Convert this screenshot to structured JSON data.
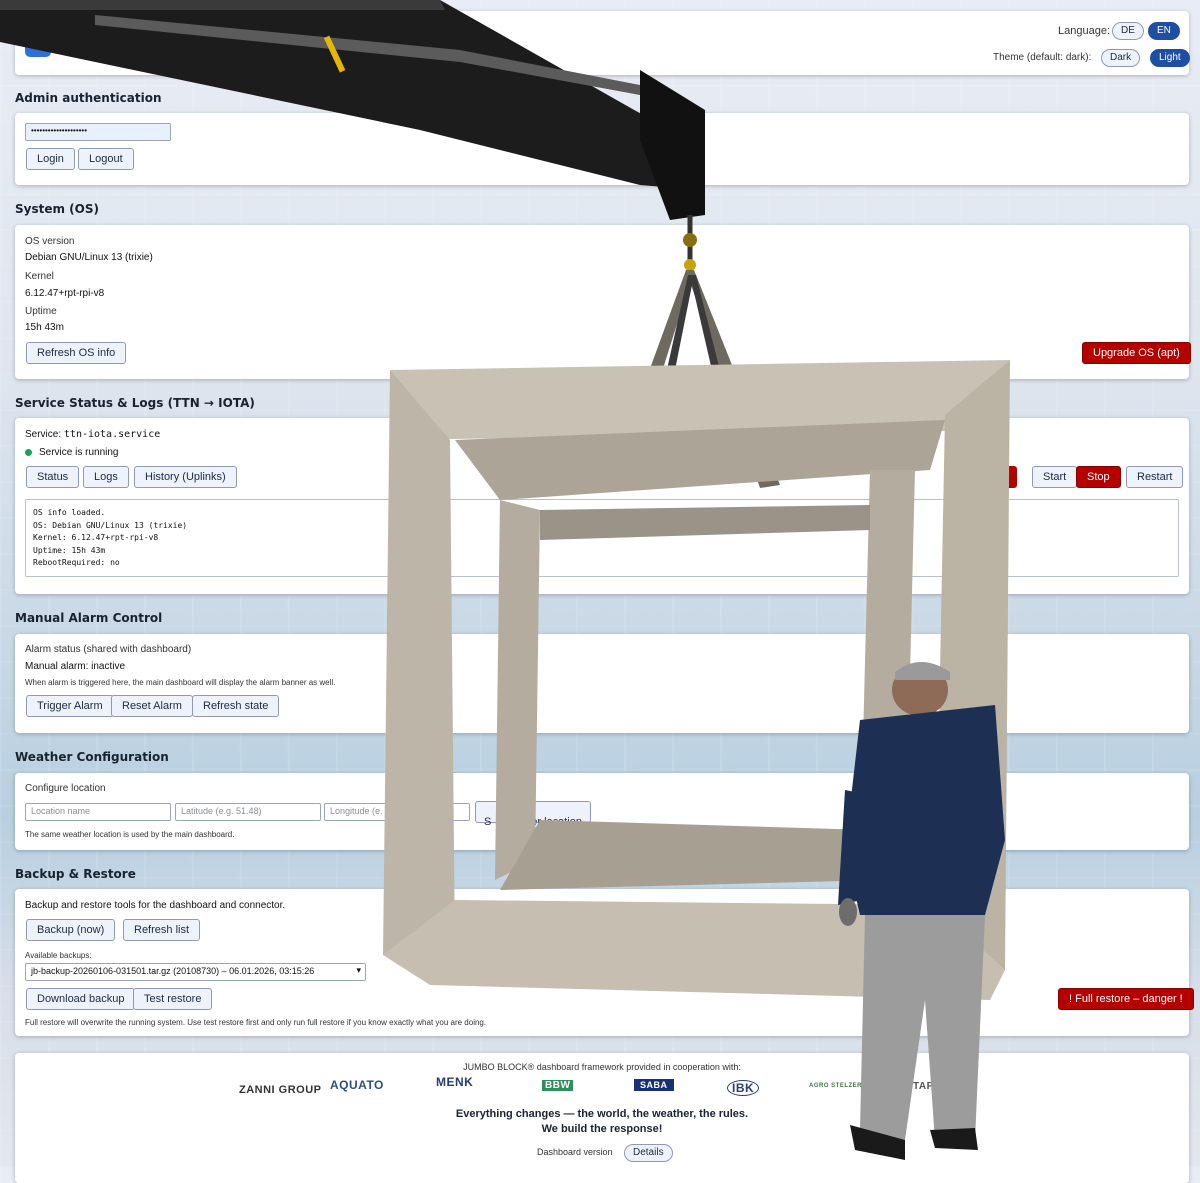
{
  "header": {
    "language_label": "Language:",
    "lang_de": "DE",
    "lang_en": "EN",
    "theme_label": "Theme (default: dark):",
    "theme_dark": "Dark",
    "theme_light": "Light"
  },
  "admin": {
    "title": "Admin authentication",
    "password_value": "••••••••••••••••••••",
    "login": "Login",
    "logout": "Logout"
  },
  "system": {
    "title": "System (OS)",
    "os_version_label": "OS version",
    "os_version": "Debian GNU/Linux 13 (trixie)",
    "kernel_label": "Kernel",
    "kernel": "6.12.47+rpt-rpi-v8",
    "uptime_label": "Uptime",
    "uptime": "15h 43m",
    "refresh": "Refresh OS info",
    "upgrade": "Upgrade OS (apt)"
  },
  "service": {
    "title": "Service Status & Logs (TTN → IOTA)",
    "service_prefix": "Service:",
    "service_name": "ttn-iota.service",
    "status_text": "Service is running",
    "status_color": "#1aa35c",
    "btn_status": "Status",
    "btn_logs": "Logs",
    "btn_history": "History (Uplinks)",
    "btn_start": "Start",
    "btn_stop": "Stop",
    "btn_restart": "Restart",
    "log": "OS info loaded.\nOS: Debian GNU/Linux 13 (trixie)\nKernel: 6.12.47+rpt-rpi-v8\nUptime: 15h 43m\nRebootRequired: no"
  },
  "alarm": {
    "title": "Manual Alarm Control",
    "status_label": "Alarm status (shared with dashboard)",
    "status": "Manual alarm: inactive",
    "note": "When alarm is triggered here, the main dashboard will display the alarm banner as well.",
    "trigger": "Trigger Alarm",
    "reset": "Reset Alarm",
    "refresh": "Refresh state"
  },
  "weather": {
    "title": "Weather Configuration",
    "configure_label": "Configure location",
    "location_placeholder": "Location name",
    "lat_placeholder": "Latitude (e.g. 51.48)",
    "lon_placeholder": "Longitude (e.",
    "save_visible_prefix": "S",
    "save_visible_suffix": "er location",
    "note": "The same weather location is used by the main dashboard."
  },
  "backup": {
    "title": "Backup & Restore",
    "intro": "Backup and restore tools for the dashboard and connector.",
    "backup_now": "Backup (now)",
    "refresh_list": "Refresh list",
    "available_label": "Available backups:",
    "selected": "jb-backup-20260106-031501.tar.gz (20108730) – 06.01.2026, 03:15:26",
    "download": "Download backup",
    "test_restore": "Test restore",
    "full_restore": "! Full restore – danger !",
    "warning": "Full restore will overwrite the running system. Use test restore first and only run full restore if you know exactly what you are doing."
  },
  "footer": {
    "cooperation": "JUMBO BLOCK® dashboard framework provided in cooperation with:",
    "partners": [
      "ZANNI GROUP",
      "AQUATO",
      "MENK",
      "BBW",
      "SABA",
      "IBK",
      "AGRO STELZER",
      "TAPro"
    ],
    "slogan_1": "Everything changes — the world, the weather, the rules.",
    "slogan_2": "We build the response!",
    "version_label": "Dashboard version",
    "details": "Details"
  }
}
